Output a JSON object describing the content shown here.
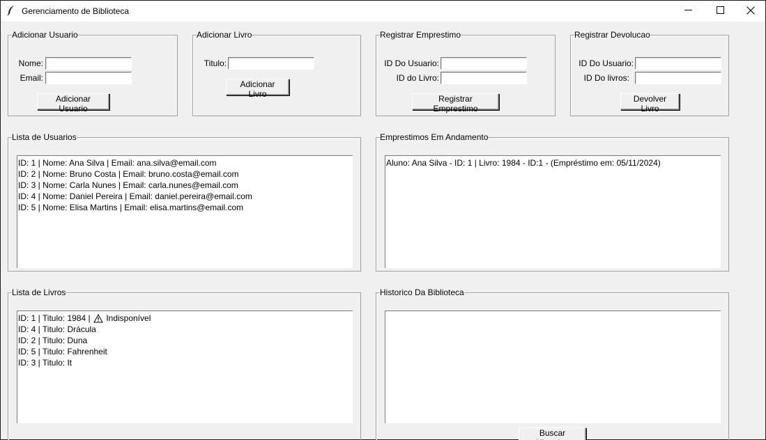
{
  "window": {
    "title": "Gerenciamento de Biblioteca",
    "icon": "feather-icon"
  },
  "add_user": {
    "legend": "Adicionar Usuario",
    "name_label": "Nome:",
    "name_value": "",
    "email_label": "Email:",
    "email_value": "",
    "button": "Adicionar Usuario"
  },
  "add_book": {
    "legend": "Adicionar Livro",
    "title_label": "Titulo:",
    "title_value": "",
    "button": "Adicionar Livro"
  },
  "register_loan": {
    "legend": "Registrar Emprestimo",
    "user_id_label": "ID Do Usuario:",
    "user_id_value": "",
    "book_id_label": "ID do Livro:",
    "book_id_value": "",
    "button": "Registrar Emprestimo"
  },
  "register_return": {
    "legend": "Registrar Devolucao",
    "user_id_label": "ID Do Usuario:",
    "user_id_value": "",
    "book_id_label": "ID Do livros:",
    "book_id_value": "",
    "button": "Devolver Livro"
  },
  "users_list": {
    "legend": "Lista de Usuarios",
    "items": [
      "ID: 1 | Nome: Ana Silva | Email: ana.silva@email.com",
      "ID: 2 | Nome: Bruno Costa | Email: bruno.costa@email.com",
      "ID: 3 | Nome: Carla Nunes | Email: carla.nunes@email.com",
      "ID: 4 | Nome: Daniel Pereira | Email: daniel.pereira@email.com",
      "ID: 5 | Nome: Elisa Martins | Email: elisa.martins@email.com"
    ]
  },
  "active_loans": {
    "legend": "Emprestimos Em Andamento",
    "items": [
      "Aluno: Ana Silva - ID: 1 |  Livro: 1984 - ID:1 - (Empréstimo em: 05/11/2024)"
    ]
  },
  "books_list": {
    "legend": "Lista de Livros",
    "items": [
      {
        "prefix": "ID: 1 | Titulo: 1984 |",
        "status_icon": "warning-icon",
        "status": "Indisponível"
      },
      {
        "prefix": "ID: 4 | Titulo: Drácula"
      },
      {
        "prefix": "ID: 2 | Titulo: Duna"
      },
      {
        "prefix": "ID: 5 | Titulo: Fahrenheit"
      },
      {
        "prefix": "ID: 3 | Titulo: It"
      }
    ]
  },
  "history": {
    "legend": "Historico Da Biblioteca",
    "items": [],
    "button": "Buscar Historico"
  }
}
